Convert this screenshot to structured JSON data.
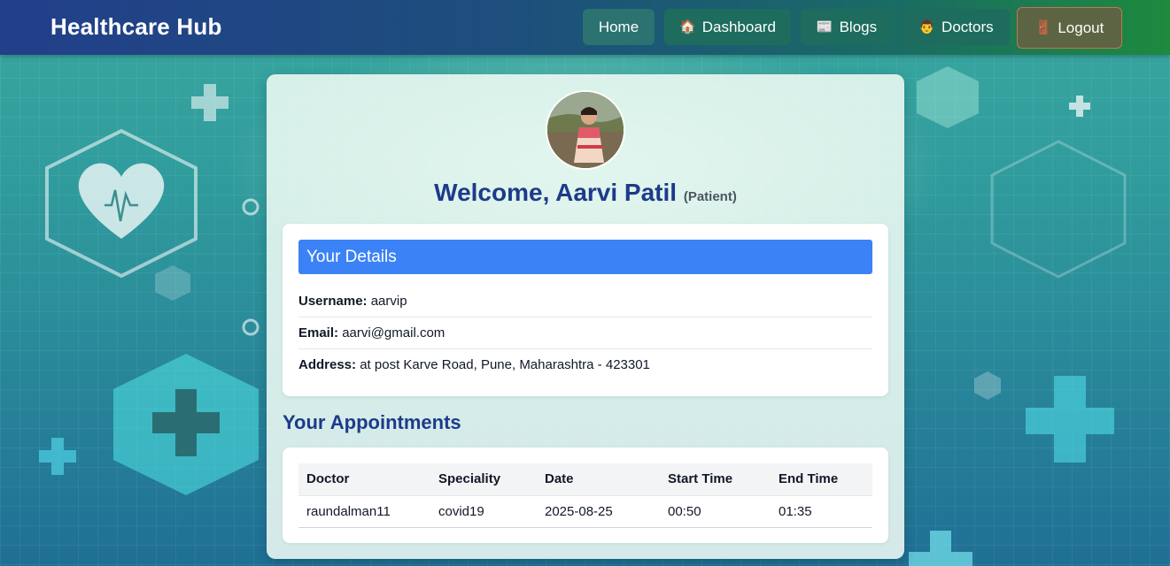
{
  "navbar": {
    "brand": "Healthcare Hub",
    "items": [
      {
        "label": "Home",
        "icon": ""
      },
      {
        "label": "Dashboard",
        "icon": "house-icon"
      },
      {
        "label": "Blogs",
        "icon": "newspaper-icon"
      },
      {
        "label": "Doctors",
        "icon": "doctor-icon"
      },
      {
        "label": "Logout",
        "icon": "door-icon"
      }
    ]
  },
  "profile": {
    "welcome": "Welcome, Aarvi Patil",
    "role": "(Patient)"
  },
  "details": {
    "heading": "Your Details",
    "rows": [
      {
        "label": "Username:",
        "value": "aarvip"
      },
      {
        "label": "Email:",
        "value": "aarvi@gmail.com"
      },
      {
        "label": "Address:",
        "value": "at post Karve Road, Pune, Maharashtra - 423301"
      }
    ]
  },
  "appointments": {
    "heading": "Your Appointments",
    "columns": [
      "Doctor",
      "Speciality",
      "Date",
      "Start Time",
      "End Time"
    ],
    "rows": [
      [
        "raundalman11",
        "covid19",
        "2025-08-25",
        "00:50",
        "01:35"
      ]
    ]
  },
  "colors": {
    "accent": "#3b82f6",
    "heading": "#1e3a8a",
    "navbar_start": "#223f8a",
    "navbar_end": "#1d8a3e"
  }
}
